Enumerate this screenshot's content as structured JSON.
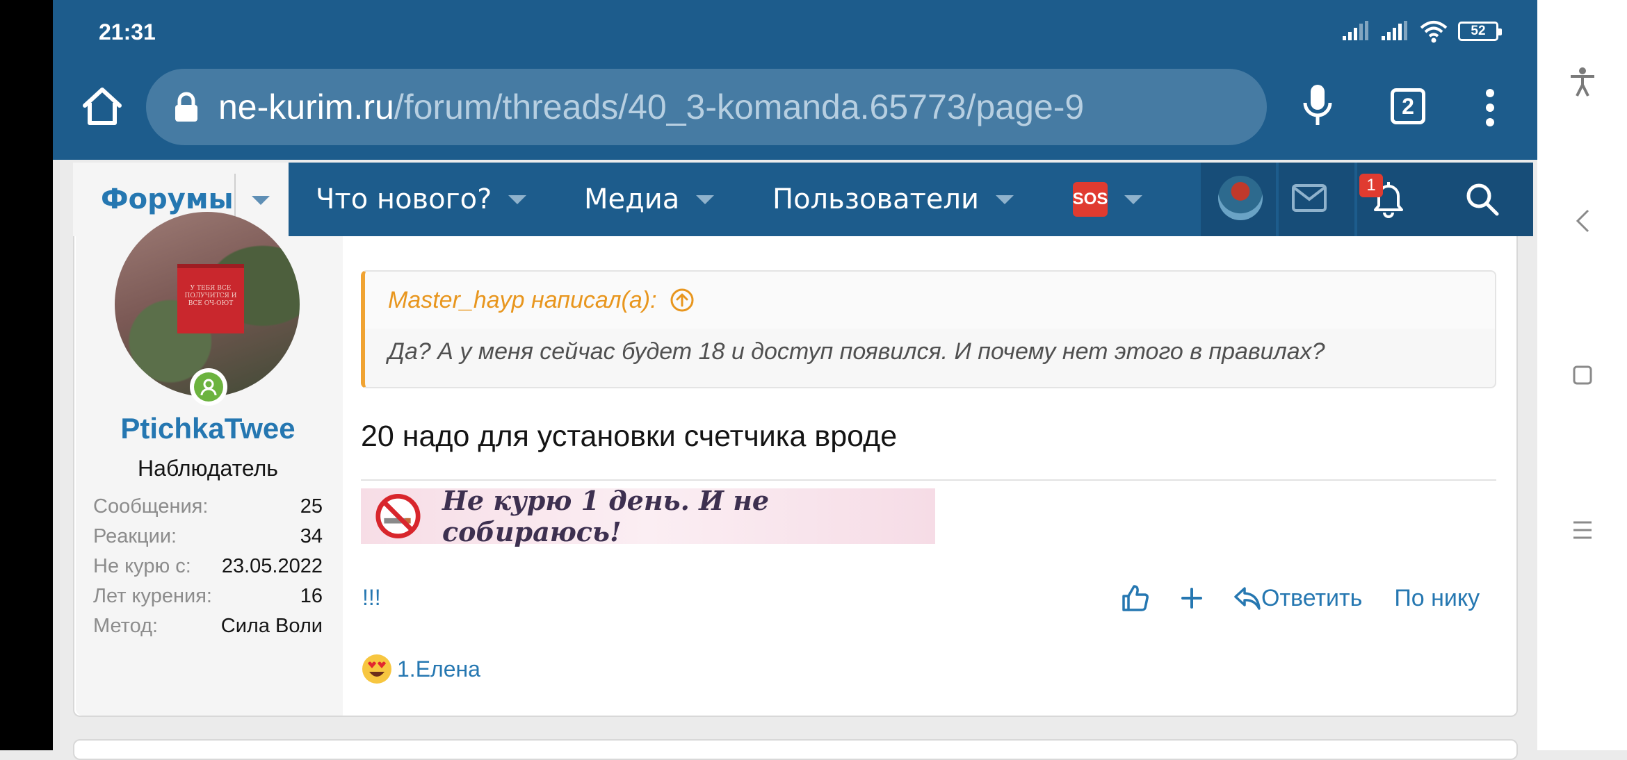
{
  "status_bar": {
    "time": "21:31",
    "battery": "52"
  },
  "browser": {
    "url_domain": "ne-kurim.ru",
    "url_path": "/forum/threads/40_3-komanda.65773/page-9",
    "tab_count": "2"
  },
  "nav": {
    "forums": "Форумы",
    "whats_new": "Что нового?",
    "media": "Медиа",
    "users": "Пользователи",
    "sos": "SOS",
    "notifications_count": "1"
  },
  "user": {
    "name": "PtichkaTwee",
    "title": "Наблюдатель",
    "avatar_caption": "У ТЕБЯ ВСЕ ПОЛУЧИТСЯ И ВСЕ ОЧ-ОЮТ",
    "stats": [
      {
        "key": "Сообщения:",
        "value": "25"
      },
      {
        "key": "Реакции:",
        "value": "34"
      },
      {
        "key": "Не курю с:",
        "value": "23.05.2022"
      },
      {
        "key": "Лет курения:",
        "value": "16"
      },
      {
        "key": "Метод:",
        "value": "Сила Воли"
      }
    ]
  },
  "post": {
    "quote_author": "Master_hayp написал(а):",
    "quote_text": "Да? А у меня сейчас будет 18 и доступ появился. И почему нет этого в правилах?",
    "message": "20 надо для установки счетчика вроде",
    "signature_banner": "Не курю 1 день. И не собираюсь!",
    "extra": "!!!",
    "actions": {
      "reply": "Ответить",
      "by_nick": "По нику"
    },
    "reaction_users": "1.Елена"
  },
  "colors": {
    "brand": "#1d5c8c",
    "link": "#2577b1",
    "quote_accent": "#f0a332",
    "badge": "#e03b30",
    "online": "#6cb33f"
  },
  "icons": [
    "home-icon",
    "lock-icon",
    "mic-icon",
    "menu-dots-icon",
    "avatar",
    "mail-icon",
    "bell-icon",
    "search-icon",
    "accessibility-icon",
    "back-icon",
    "recents-icon",
    "menu-icon",
    "like-icon",
    "plus-icon",
    "reply-icon",
    "heart-eyes-emoji",
    "no-smoking-icon",
    "arrow-up-circle-icon"
  ]
}
